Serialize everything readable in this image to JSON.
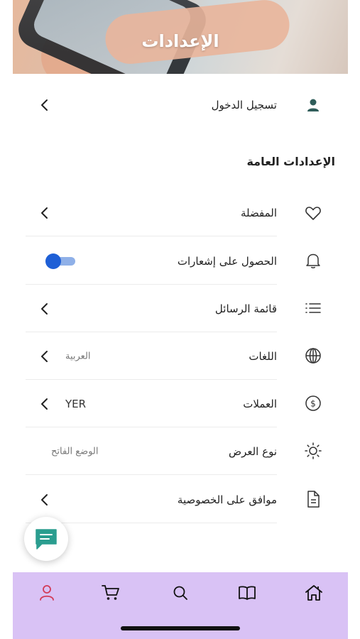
{
  "header": {
    "title": "الإعدادات"
  },
  "login": {
    "label": "تسجيل الدخول",
    "icon": "user-icon"
  },
  "general_settings": {
    "title": "الإعدادات العامة",
    "items": [
      {
        "label": "المفضلة",
        "icon": "heart-icon"
      },
      {
        "label": "الحصول على إشعارات",
        "icon": "bell-icon",
        "toggle_on": true
      },
      {
        "label": "قائمة الرسائل",
        "icon": "list-icon"
      },
      {
        "label": "اللغات",
        "icon": "globe-icon",
        "value": "العربية"
      },
      {
        "label": "العملات",
        "icon": "dollar-icon",
        "value": "YER"
      },
      {
        "label": "نوع العرض",
        "icon": "sun-icon",
        "value": "الوضع الفاتح"
      },
      {
        "label": "موافق على الخصوصية",
        "icon": "document-icon"
      }
    ]
  },
  "bottom_nav": {
    "items": [
      {
        "name": "profile",
        "icon": "user-icon",
        "active": true
      },
      {
        "name": "cart",
        "icon": "cart-icon"
      },
      {
        "name": "search",
        "icon": "search-icon"
      },
      {
        "name": "catalog",
        "icon": "book-icon"
      },
      {
        "name": "home",
        "icon": "home-icon"
      }
    ]
  },
  "colors": {
    "accent": "#1e5fd6",
    "nav_background": "#d9c2f5",
    "active_nav": "#d23b57",
    "chat_icon": "#2a9d8f"
  }
}
